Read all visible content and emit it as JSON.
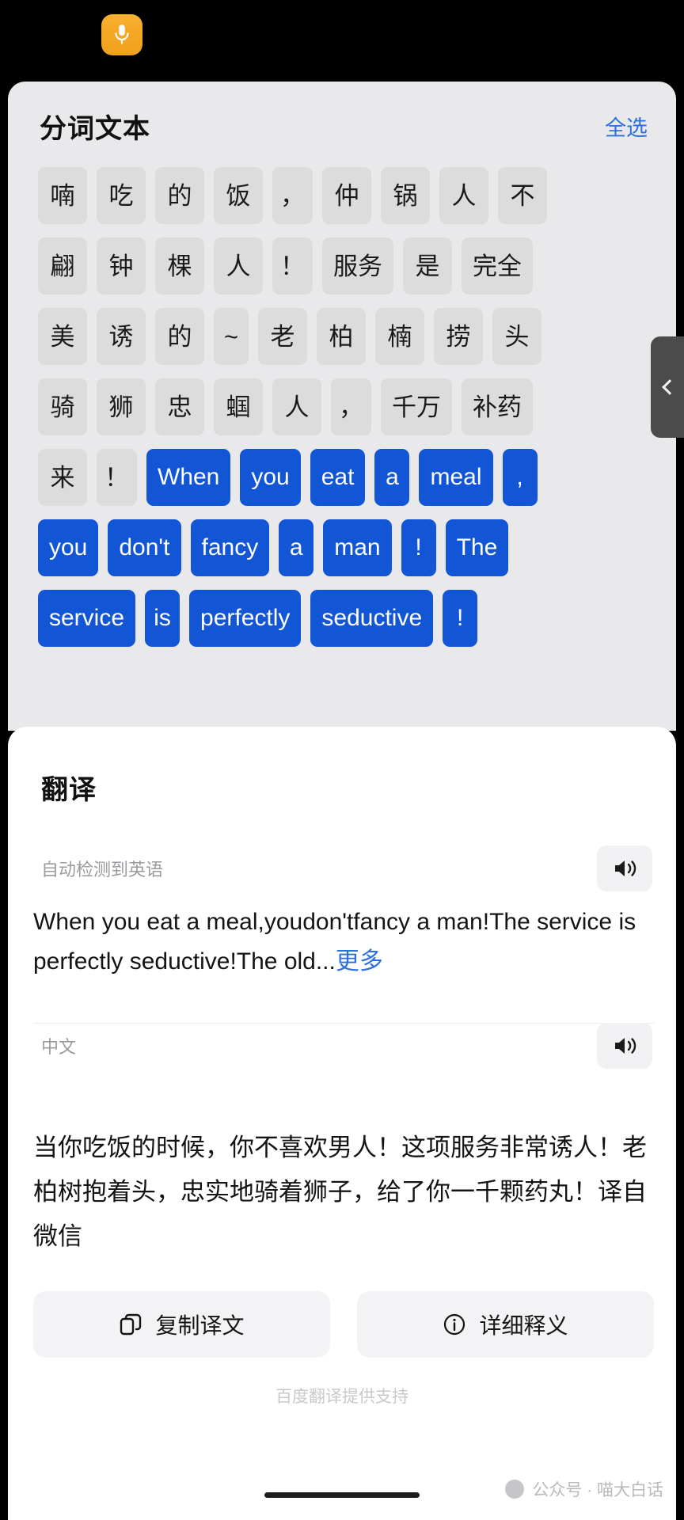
{
  "statusbar": {
    "mic_icon": "microphone-icon"
  },
  "segmentation": {
    "title": "分词文本",
    "select_all_label": "全选",
    "handle_icon": "chevron-left-icon",
    "rows": [
      [
        {
          "t": "喃",
          "sel": false,
          "narrow": false
        },
        {
          "t": "吃",
          "sel": false,
          "narrow": false
        },
        {
          "t": "的",
          "sel": false,
          "narrow": false
        },
        {
          "t": "饭",
          "sel": false,
          "narrow": false
        },
        {
          "t": "，",
          "sel": false,
          "narrow": true
        },
        {
          "t": "仲",
          "sel": false,
          "narrow": false
        },
        {
          "t": "锅",
          "sel": false,
          "narrow": false
        },
        {
          "t": "人",
          "sel": false,
          "narrow": false
        },
        {
          "t": "不",
          "sel": false,
          "narrow": false
        }
      ],
      [
        {
          "t": "翩",
          "sel": false,
          "narrow": false
        },
        {
          "t": "钟",
          "sel": false,
          "narrow": false
        },
        {
          "t": "棵",
          "sel": false,
          "narrow": false
        },
        {
          "t": "人",
          "sel": false,
          "narrow": false
        },
        {
          "t": "！",
          "sel": false,
          "narrow": true
        },
        {
          "t": "服务",
          "sel": false,
          "narrow": false
        },
        {
          "t": "是",
          "sel": false,
          "narrow": false
        },
        {
          "t": "完全",
          "sel": false,
          "narrow": false
        }
      ],
      [
        {
          "t": "美",
          "sel": false,
          "narrow": false
        },
        {
          "t": "诱",
          "sel": false,
          "narrow": false
        },
        {
          "t": "的",
          "sel": false,
          "narrow": false
        },
        {
          "t": "~",
          "sel": false,
          "narrow": true
        },
        {
          "t": "老",
          "sel": false,
          "narrow": false
        },
        {
          "t": "柏",
          "sel": false,
          "narrow": false
        },
        {
          "t": "楠",
          "sel": false,
          "narrow": false
        },
        {
          "t": "捞",
          "sel": false,
          "narrow": false
        },
        {
          "t": "头",
          "sel": false,
          "narrow": false
        }
      ],
      [
        {
          "t": "骑",
          "sel": false,
          "narrow": false
        },
        {
          "t": "狮",
          "sel": false,
          "narrow": false
        },
        {
          "t": "忠",
          "sel": false,
          "narrow": false
        },
        {
          "t": "蝈",
          "sel": false,
          "narrow": false
        },
        {
          "t": "人",
          "sel": false,
          "narrow": false
        },
        {
          "t": "，",
          "sel": false,
          "narrow": true
        },
        {
          "t": "千万",
          "sel": false,
          "narrow": false
        },
        {
          "t": "补药",
          "sel": false,
          "narrow": false
        }
      ],
      [
        {
          "t": "来",
          "sel": false,
          "narrow": false
        },
        {
          "t": "！",
          "sel": false,
          "narrow": true
        },
        {
          "t": "When",
          "sel": true,
          "narrow": false
        },
        {
          "t": "you",
          "sel": true,
          "narrow": false
        },
        {
          "t": "eat",
          "sel": true,
          "narrow": false
        },
        {
          "t": "a",
          "sel": true,
          "narrow": true
        },
        {
          "t": "meal",
          "sel": true,
          "narrow": false
        },
        {
          "t": ",",
          "sel": true,
          "narrow": true
        }
      ],
      [
        {
          "t": "you",
          "sel": true,
          "narrow": false
        },
        {
          "t": "don't",
          "sel": true,
          "narrow": false
        },
        {
          "t": "fancy",
          "sel": true,
          "narrow": false
        },
        {
          "t": "a",
          "sel": true,
          "narrow": true
        },
        {
          "t": "man",
          "sel": true,
          "narrow": false
        },
        {
          "t": "!",
          "sel": true,
          "narrow": true
        },
        {
          "t": "The",
          "sel": true,
          "narrow": false
        }
      ],
      [
        {
          "t": "service",
          "sel": true,
          "narrow": false
        },
        {
          "t": "is",
          "sel": true,
          "narrow": true
        },
        {
          "t": "perfectly",
          "sel": true,
          "narrow": false
        },
        {
          "t": "seductive",
          "sel": true,
          "narrow": false
        },
        {
          "t": "!",
          "sel": true,
          "narrow": true
        }
      ]
    ]
  },
  "translate": {
    "title": "翻译",
    "source": {
      "lang_label": "自动检测到英语",
      "speaker_icon": "speaker-icon",
      "text": "When you eat a meal,youdon'tfancy a man!The service is perfectly seductive!The old...",
      "more_label": "更多"
    },
    "target": {
      "lang_label": "中文",
      "speaker_icon": "speaker-icon",
      "text": "当你吃饭的时候，你不喜欢男人！这项服务非常诱人！老柏树抱着头，忠实地骑着狮子，给了你一千颗药丸！译自微信"
    },
    "actions": [
      {
        "label": "复制译文",
        "icon": "copy-icon"
      },
      {
        "label": "详细释义",
        "icon": "info-icon"
      }
    ],
    "footer": "百度翻译提供支持"
  },
  "watermark": {
    "text": "公众号 · 喵大白话",
    "icon": "globe-icon"
  }
}
